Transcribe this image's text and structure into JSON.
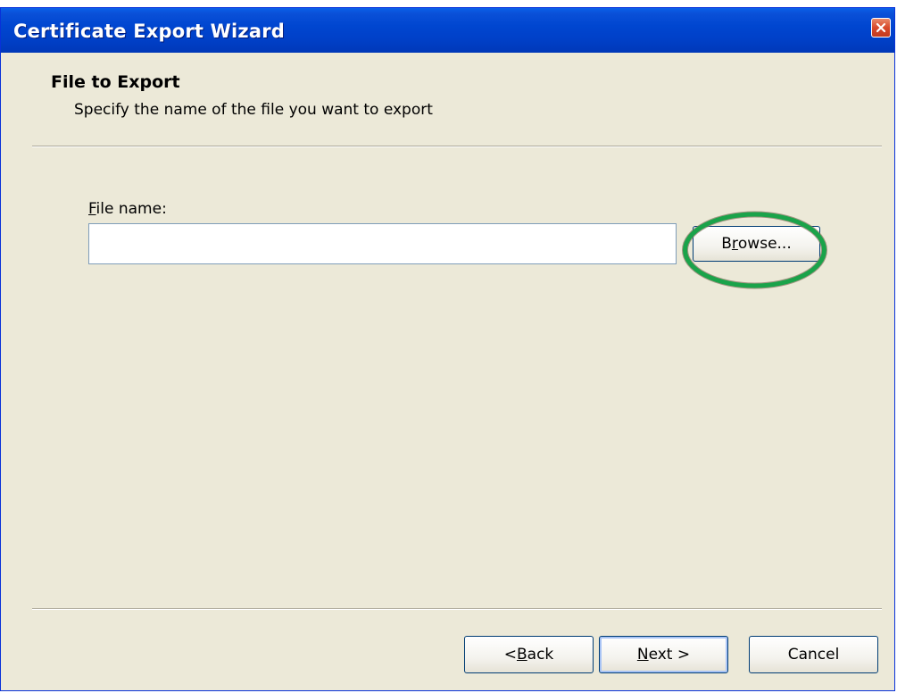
{
  "window": {
    "title": "Certificate Export Wizard",
    "close_icon": "close-icon"
  },
  "header": {
    "title": "File to Export",
    "subtitle": "Specify the name of the file you want to export"
  },
  "form": {
    "file_name_label_mnemonic": "F",
    "file_name_label_rest": "ile name:",
    "file_name_value": "",
    "browse_mnemonic_pre": "B",
    "browse_mnemonic": "r",
    "browse_rest": "owse..."
  },
  "footer": {
    "back_pre": "< ",
    "back_mnemonic": "B",
    "back_rest": "ack",
    "next_mnemonic": "N",
    "next_rest": "ext >",
    "cancel_label": "Cancel"
  },
  "annotation": {
    "highlight_color": "#1aa34a"
  }
}
